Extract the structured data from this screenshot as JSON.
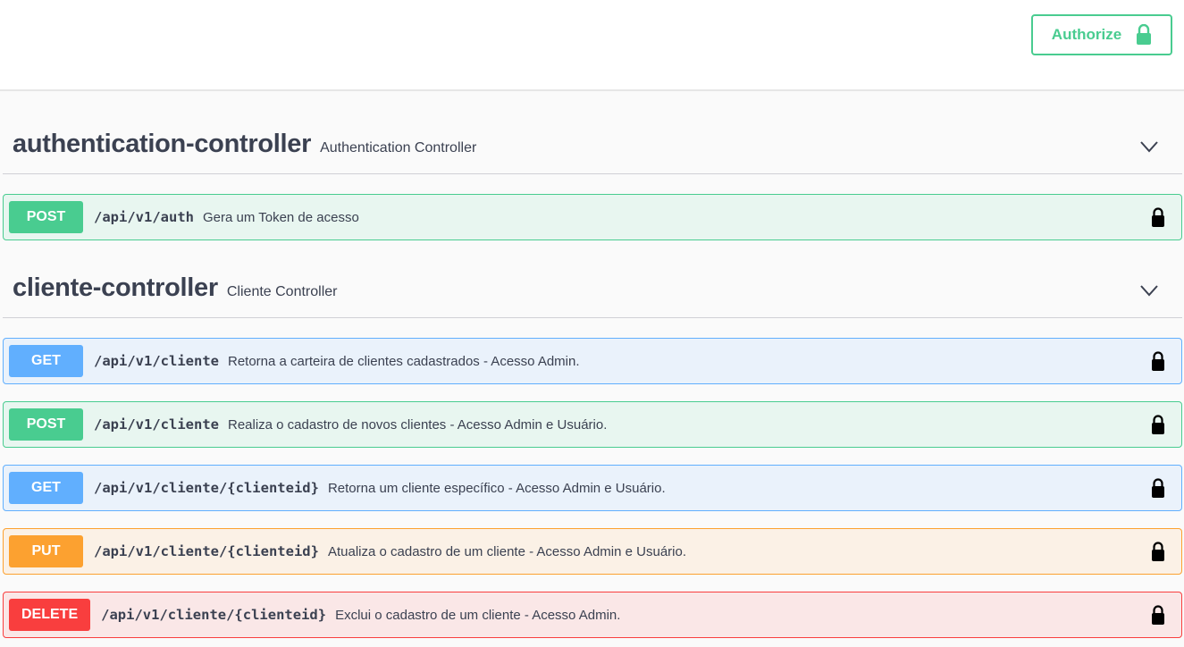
{
  "header": {
    "authorize_label": "Authorize",
    "authorize_icon": "lock-icon",
    "accent": "#49cc90"
  },
  "tags": [
    {
      "name": "authentication-controller",
      "description": "Authentication Controller",
      "operations": [
        {
          "method": "POST",
          "path": "/api/v1/auth",
          "summary": "Gera um Token de acesso"
        }
      ]
    },
    {
      "name": "cliente-controller",
      "description": "Cliente Controller",
      "operations": [
        {
          "method": "GET",
          "path": "/api/v1/cliente",
          "summary": "Retorna a carteira de clientes cadastrados - Acesso Admin."
        },
        {
          "method": "POST",
          "path": "/api/v1/cliente",
          "summary": "Realiza o cadastro de novos clientes - Acesso Admin e Usuário."
        },
        {
          "method": "GET",
          "path": "/api/v1/cliente/{clienteid}",
          "summary": "Retorna um cliente específico - Acesso Admin e Usuário."
        },
        {
          "method": "PUT",
          "path": "/api/v1/cliente/{clienteid}",
          "summary": "Atualiza o cadastro de um cliente - Acesso Admin e Usuário."
        },
        {
          "method": "DELETE",
          "path": "/api/v1/cliente/{clienteid}",
          "summary": "Exclui o cadastro de um cliente - Acesso Admin."
        }
      ]
    }
  ],
  "colors": {
    "get": "#61affe",
    "post": "#49cc90",
    "put": "#fca130",
    "delete": "#f93e3e"
  }
}
